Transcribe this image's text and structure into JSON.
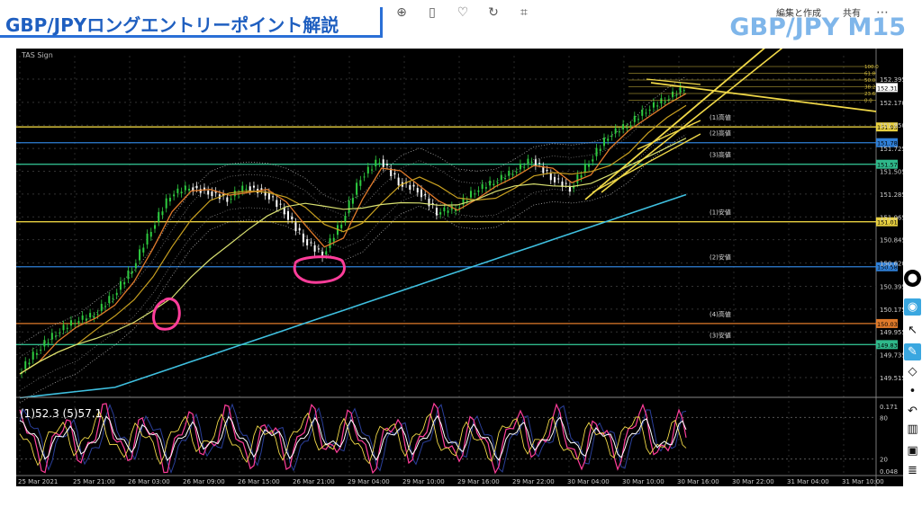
{
  "banner": {
    "title": "GBP/JPYロングエントリーポイント解説"
  },
  "pair_title": "GBP/JPY M15",
  "toolbar": {
    "share_label": "共有",
    "edit_label": "編集と作成"
  },
  "indicator_label": "TAS Sign",
  "oscillator_label": "(1)52.3 (5)57.1",
  "colors": {
    "accent": "#2a6fd6",
    "yellow": "#e8d040",
    "blue": "#2f7fd6",
    "green": "#2fb88a",
    "orange": "#e07a2a",
    "pink": "#ff3d9a",
    "cyan": "#3fc0e0"
  },
  "chart_data": {
    "type": "line",
    "title": "GBP/JPY M15",
    "ylim": [
      149.35,
      152.62
    ],
    "y_ticks": [
      "152.395",
      "152.170",
      "151.950",
      "151.725",
      "151.505",
      "151.285",
      "151.065",
      "150.845",
      "150.620",
      "150.395",
      "150.175",
      "149.955",
      "149.735",
      "149.515"
    ],
    "x_ticks": [
      "25 Mar 2021",
      "25 Mar 21:00",
      "26 Mar 03:00",
      "26 Mar 09:00",
      "26 Mar 15:00",
      "26 Mar 21:00",
      "29 Mar 04:00",
      "29 Mar 10:00",
      "29 Mar 16:00",
      "29 Mar 22:00",
      "30 Mar 04:00",
      "30 Mar 10:00",
      "30 Mar 16:00",
      "30 Mar 22:00",
      "31 Mar 04:00",
      "31 Mar 10:00"
    ],
    "current_price": "152.313",
    "levels": [
      {
        "price": 151.933,
        "label": "151.933",
        "name": "(1)高値",
        "color": "#e8d040"
      },
      {
        "price": 151.781,
        "label": "151.781",
        "name": "(2)高値",
        "color": "#2f7fd6"
      },
      {
        "price": 151.573,
        "label": "151.573",
        "name": "(3)高値",
        "color": "#2fb88a"
      },
      {
        "price": 151.018,
        "label": "151.018",
        "name": "(1)安値",
        "color": "#e8d040"
      },
      {
        "price": 150.584,
        "label": "150.584",
        "name": "(2)安値",
        "color": "#2f7fd6"
      },
      {
        "price": 150.036,
        "label": "150.036",
        "name": "(4)高値",
        "color": "#e07a2a"
      },
      {
        "price": 149.833,
        "label": "149.833",
        "name": "(3)安値",
        "color": "#2fb88a"
      }
    ],
    "fib_levels": [
      "100.0",
      "61.8",
      "50.0",
      "38.2",
      "23.6",
      "0.0"
    ],
    "price_path": [
      149.55,
      149.78,
      149.95,
      150.06,
      150.12,
      150.31,
      150.57,
      150.95,
      151.28,
      151.35,
      151.31,
      151.24,
      151.36,
      151.3,
      151.12,
      150.85,
      150.7,
      151.02,
      151.45,
      151.62,
      151.4,
      151.33,
      151.11,
      151.15,
      151.32,
      151.4,
      151.5,
      151.62,
      151.45,
      151.34,
      151.6,
      151.85,
      151.95,
      152.1,
      152.2,
      152.31
    ],
    "oscillator": {
      "ylim": [
        0,
        100
      ],
      "ticks": [
        "0.171",
        "80",
        "20",
        "0.048"
      ]
    }
  }
}
